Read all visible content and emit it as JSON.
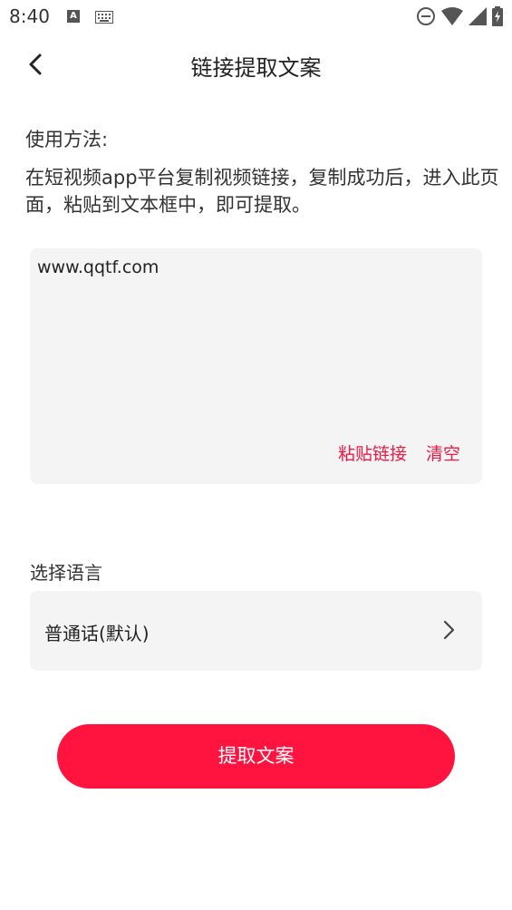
{
  "status_bar": {
    "time": "8:40",
    "notification_icon_letter": "A"
  },
  "header": {
    "title": "链接提取文案"
  },
  "usage": {
    "label": "使用方法:",
    "description": "在短视频app平台复制视频链接，复制成功后，进入此页面，粘贴到文本框中，即可提取。"
  },
  "input": {
    "value": "www.qqtf.com",
    "paste_label": "粘贴链接",
    "clear_label": "清空"
  },
  "language": {
    "label": "选择语言",
    "selected": "普通话(默认)"
  },
  "actions": {
    "extract_label": "提取文案"
  },
  "colors": {
    "accent": "#ff1440",
    "link": "#ef1a45",
    "field_bg": "#f4f4f4"
  }
}
